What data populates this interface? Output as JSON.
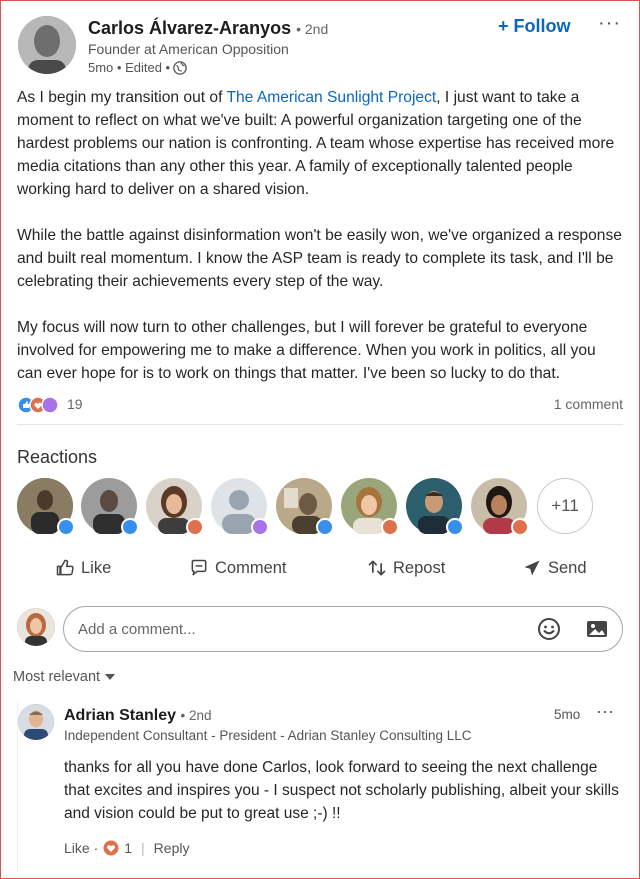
{
  "post": {
    "author": {
      "name": "Carlos Álvarez-Aranyos",
      "degree": "• 2nd",
      "headline": "Founder at American Opposition",
      "time": "5mo • Edited •"
    },
    "follow_label": "+ Follow",
    "more_label": "···",
    "body": {
      "p1_before": "As I begin my transition out of ",
      "p1_link": "The American Sunlight Project",
      "p1_after": ", I just want to take a moment to reflect on what we've built: A powerful organization targeting one of the hardest problems our nation is confronting. A team whose expertise has received more media citations than any other this year. A family of exceptionally talented people working hard to deliver on a shared vision.",
      "p2": "While the battle against disinformation won't be easily won, we've organized a response and built real momentum. I know the ASP team is ready to complete its task, and I'll be celebrating their achievements every step of the way.",
      "p3": "My focus will now turn to other challenges, but I will forever be grateful to everyone involved for empowering me to make a difference. When you work in politics, all you can ever hope for is to work on things that matter. I've been so lucky to do that."
    },
    "reaction_count": "19",
    "comment_count": "1 comment"
  },
  "reactions": {
    "title": "Reactions",
    "more_label": "+11",
    "people": [
      {
        "badge": "like"
      },
      {
        "badge": "like"
      },
      {
        "badge": "love"
      },
      {
        "badge": "support"
      },
      {
        "badge": "like"
      },
      {
        "badge": "love"
      },
      {
        "badge": "like"
      },
      {
        "badge": "love"
      }
    ]
  },
  "actions": {
    "like": "Like",
    "comment": "Comment",
    "repost": "Repost",
    "send": "Send"
  },
  "comment_input": {
    "placeholder": "Add a comment..."
  },
  "sort": {
    "label": "Most relevant"
  },
  "comment": {
    "name": "Adrian Stanley",
    "degree": "• 2nd",
    "headline": "Independent Consultant - President - Adrian Stanley Consulting LLC",
    "time": "5mo",
    "more_label": "···",
    "text": "thanks for all you have done Carlos, look forward to seeing the next challenge that excites and inspires you - I suspect not scholarly publishing, albeit your skills and vision could be put to great use ;-) !!",
    "like_label": "Like ·",
    "love_count": "1",
    "separator": "|",
    "reply_label": "Reply"
  },
  "colors": {
    "link": "#0a66c2",
    "like": "#378fe9",
    "love": "#df704d",
    "support": "#a872e8"
  }
}
